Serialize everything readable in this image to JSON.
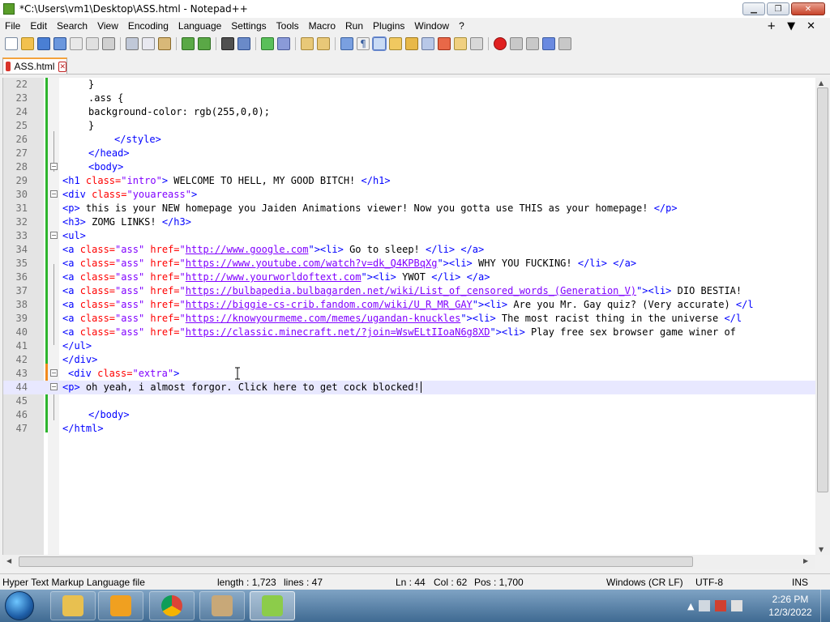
{
  "window": {
    "title": "*C:\\Users\\vm1\\Desktop\\ASS.html - Notepad++"
  },
  "menu": [
    "File",
    "Edit",
    "Search",
    "View",
    "Encoding",
    "Language",
    "Settings",
    "Tools",
    "Macro",
    "Run",
    "Plugins",
    "Window",
    "?"
  ],
  "menu_right": {
    "plus": "+",
    "dropdown": "▼",
    "close": "✕"
  },
  "tab": {
    "label": "ASS.html"
  },
  "code": {
    "l22": {
      "n": "22",
      "t": "}"
    },
    "l23": {
      "n": "23",
      "t": ".ass {"
    },
    "l24": {
      "n": "24",
      "t": "background-color: rgb(255,0,0);"
    },
    "l25": {
      "n": "25",
      "t": "}"
    },
    "l26": {
      "n": "26",
      "t": "</style>"
    },
    "l27": {
      "n": "27",
      "t": "</head>"
    },
    "l28": {
      "n": "28",
      "t": "<body>"
    },
    "l29": {
      "n": "29",
      "open": "<h1 ",
      "a": "class=",
      "v": "\"intro\"",
      "close": ">",
      "text": " WELCOME TO HELL, MY GOOD BITCH! ",
      "end": "</h1>"
    },
    "l30": {
      "n": "30",
      "open": "<div ",
      "a": "class=",
      "v": "\"youareass\"",
      "close": ">"
    },
    "l31": {
      "n": "31",
      "open": "<p>",
      "text": " this is your NEW homepage you Jaiden Animations viewer! Now you gotta use THIS as your homepage! ",
      "end": "</p>"
    },
    "l32": {
      "n": "32",
      "open": "<h3>",
      "text": " ZOMG LINKS! ",
      "end": "</h3>"
    },
    "l33": {
      "n": "33",
      "open": "<ul>"
    },
    "l34": {
      "n": "34",
      "href": "http://www.google.com",
      "text": " Go to sleep! "
    },
    "l35": {
      "n": "35",
      "href": "https://www.youtube.com/watch?v=dk_Q4KPBqXg",
      "text": " WHY YOU FUCKING! "
    },
    "l36": {
      "n": "36",
      "href": "http://www.yourworldoftext.com",
      "text": " YWOT "
    },
    "l37": {
      "n": "37",
      "href": "https://bulbapedia.bulbagarden.net/wiki/List_of_censored_words_(Generation_V)",
      "text": " DIO BESTIA!"
    },
    "l38": {
      "n": "38",
      "href": "https://biggie-cs-crib.fandom.com/wiki/U_R_MR_GAY",
      "text": " Are you Mr. Gay quiz? (Very accurate) ",
      "tail": "</l"
    },
    "l39": {
      "n": "39",
      "href": "https://knowyourmeme.com/memes/ugandan-knuckles",
      "text": " The most racist thing in the universe ",
      "tail": "</l"
    },
    "l40": {
      "n": "40",
      "href": "https://classic.minecraft.net/?join=WswELtIIoaN6g8XD",
      "text": " Play free sex browser game winer of"
    },
    "l41": {
      "n": "41",
      "t": "</ul>"
    },
    "l42": {
      "n": "42",
      "t": "</div>"
    },
    "l43": {
      "n": "43",
      "open": "<div ",
      "a": "class=",
      "v": "\"extra\"",
      "close": ">"
    },
    "l44": {
      "n": "44",
      "open": "<p>",
      "text": " oh yeah, i almost forgor. Click here to get cock blocked!"
    },
    "l45": {
      "n": "45"
    },
    "l46": {
      "n": "46",
      "t": "</body>"
    },
    "l47": {
      "n": "47",
      "t": "</html>"
    },
    "tokens": {
      "a_open": "<a ",
      "a_class": "class=",
      "a_class_val": "\"ass\"",
      "a_href": " href=",
      "q": "\"",
      "li_open": "\"><li>",
      "li_close": "</li>",
      "a_close": " </a>"
    }
  },
  "status": {
    "file_type": "Hyper Text Markup Language file",
    "length": "length : 1,723",
    "lines": "lines : 47",
    "ln": "Ln : 44",
    "col": "Col : 62",
    "pos": "Pos : 1,700",
    "eol": "Windows (CR LF)",
    "encoding": "UTF-8",
    "mode": "INS"
  },
  "taskbar": {
    "time": "2:26 PM",
    "date": "12/3/2022"
  },
  "colors": {
    "tag": "#0000ff",
    "attr": "#ff0000",
    "value": "#8000ff",
    "changed_line": "#2db52d",
    "unsaved_line": "#f28a1c"
  }
}
